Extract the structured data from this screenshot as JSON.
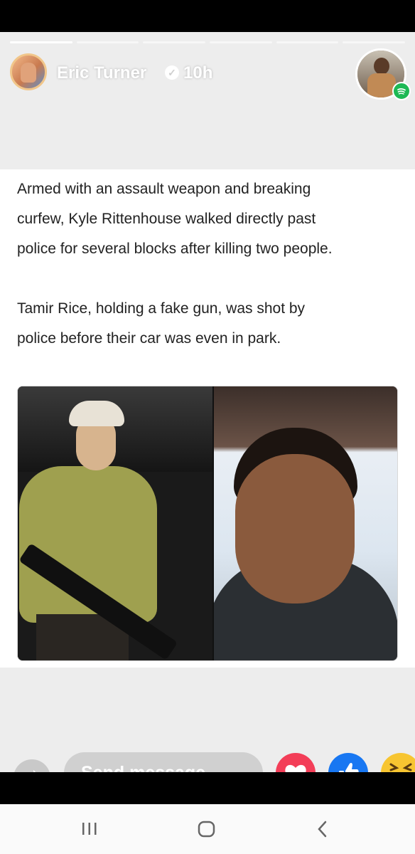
{
  "story": {
    "progress_segments": 6,
    "active_segment_index": 0,
    "author_name": "Eric Turner",
    "verified_icon": "verified-check-icon",
    "timestamp": "10h",
    "music_badge_icon": "spotify-icon"
  },
  "post": {
    "paragraphs": [
      "Armed with an assault weapon and breaking\ncurfew, Kyle Rittenhouse walked directly past\npolice for several blocks after killing two people.",
      "Tamir Rice, holding a fake gun, was shot by\npolice before their car was even in park."
    ]
  },
  "reply_bar": {
    "share_icon": "share-arrow-icon",
    "message_placeholder": "Send message...",
    "reactions": [
      "love-reaction-icon",
      "like-reaction-icon",
      "haha-reaction-icon"
    ]
  },
  "colors": {
    "love": "#f33e58",
    "like": "#1877f2",
    "haha": "#f7c531",
    "spotify": "#1db954"
  },
  "system_nav": {
    "recents_icon": "recents-icon",
    "home_icon": "home-icon",
    "back_icon": "back-icon"
  }
}
